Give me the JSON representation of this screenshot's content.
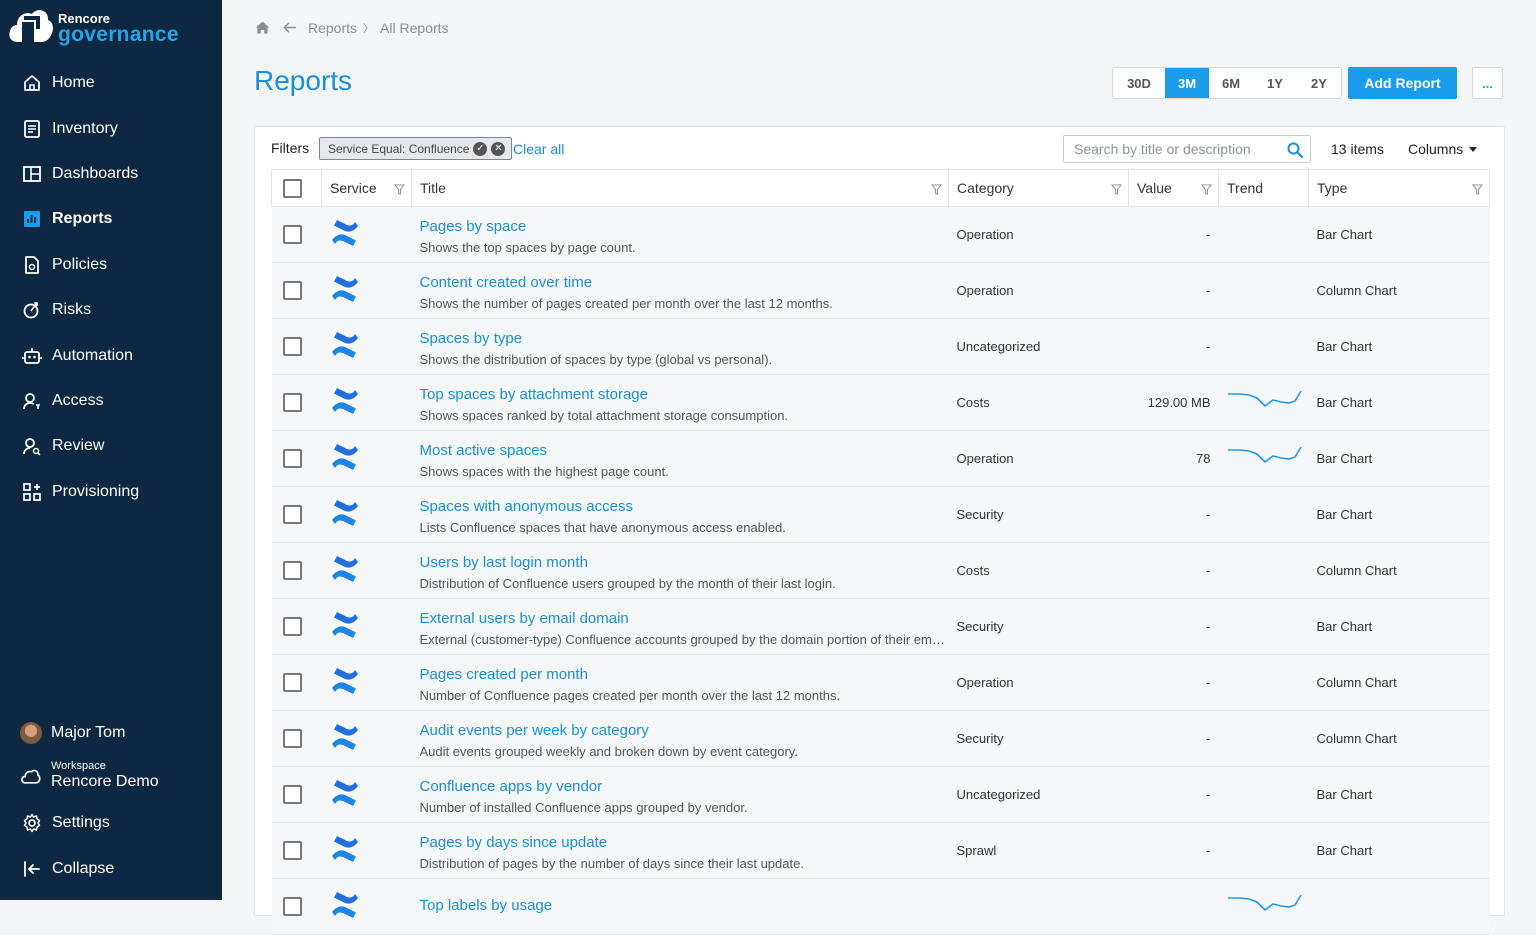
{
  "brand": {
    "line1": "Rencore",
    "line2": "governance"
  },
  "nav": [
    {
      "label": "Home",
      "icon": "home-icon"
    },
    {
      "label": "Inventory",
      "icon": "inventory-icon"
    },
    {
      "label": "Dashboards",
      "icon": "dashboards-icon"
    },
    {
      "label": "Reports",
      "icon": "reports-icon",
      "active": true
    },
    {
      "label": "Policies",
      "icon": "policies-icon"
    },
    {
      "label": "Risks",
      "icon": "risks-icon"
    },
    {
      "label": "Automation",
      "icon": "automation-icon"
    },
    {
      "label": "Access",
      "icon": "access-icon"
    },
    {
      "label": "Review",
      "icon": "review-icon"
    },
    {
      "label": "Provisioning",
      "icon": "provisioning-icon"
    }
  ],
  "user": {
    "name": "Major Tom"
  },
  "workspace": {
    "label": "Workspace",
    "name": "Rencore Demo"
  },
  "bottom_nav": {
    "settings": "Settings",
    "collapse": "Collapse"
  },
  "breadcrumb": {
    "reports": "Reports",
    "sep": "〉",
    "all": "All Reports"
  },
  "page_title": "Reports",
  "periods": [
    "30D",
    "3M",
    "6M",
    "1Y",
    "2Y"
  ],
  "selected_period": "3M",
  "add_report": "Add Report",
  "more": "...",
  "filters": {
    "label": "Filters",
    "chip": "Service Equal: Confluence",
    "clear": "Clear all"
  },
  "search": {
    "placeholder": "Search by title or description"
  },
  "items_count": "13 items",
  "columns_label": "Columns",
  "table": {
    "headers": {
      "service": "Service",
      "title": "Title",
      "category": "Category",
      "value": "Value",
      "trend": "Trend",
      "type": "Type"
    },
    "rows": [
      {
        "title": "Pages by space",
        "desc": "Shows the top spaces by page count.",
        "category": "Operation",
        "value": "-",
        "trend": false,
        "type": "Bar Chart"
      },
      {
        "title": "Content created over time",
        "desc": "Shows the number of pages created per month over the last 12 months.",
        "category": "Operation",
        "value": "-",
        "trend": false,
        "type": "Column Chart"
      },
      {
        "title": "Spaces by type",
        "desc": "Shows the distribution of spaces by type (global vs personal).",
        "category": "Uncategorized",
        "value": "-",
        "trend": false,
        "type": "Bar Chart"
      },
      {
        "title": "Top spaces by attachment storage",
        "desc": "Shows spaces ranked by total attachment storage consumption.",
        "category": "Costs",
        "value": "129.00 MB",
        "trend": true,
        "type": "Bar Chart"
      },
      {
        "title": "Most active spaces",
        "desc": "Shows spaces with the highest page count.",
        "category": "Operation",
        "value": "78",
        "trend": true,
        "type": "Bar Chart"
      },
      {
        "title": "Spaces with anonymous access",
        "desc": "Lists Confluence spaces that have anonymous access enabled.",
        "category": "Security",
        "value": "-",
        "trend": false,
        "type": "Bar Chart"
      },
      {
        "title": "Users by last login month",
        "desc": "Distribution of Confluence users grouped by the month of their last login.",
        "category": "Costs",
        "value": "-",
        "trend": false,
        "type": "Column Chart"
      },
      {
        "title": "External users by email domain",
        "desc": "External (customer-type) Confluence accounts grouped by the domain portion of their email address.",
        "category": "Security",
        "value": "-",
        "trend": false,
        "type": "Bar Chart"
      },
      {
        "title": "Pages created per month",
        "desc": "Number of Confluence pages created per month over the last 12 months.",
        "category": "Operation",
        "value": "-",
        "trend": false,
        "type": "Column Chart"
      },
      {
        "title": "Audit events per week by category",
        "desc": "Audit events grouped weekly and broken down by event category.",
        "category": "Security",
        "value": "-",
        "trend": false,
        "type": "Column Chart"
      },
      {
        "title": "Confluence apps by vendor",
        "desc": "Number of installed Confluence apps grouped by vendor.",
        "category": "Uncategorized",
        "value": "-",
        "trend": false,
        "type": "Bar Chart"
      },
      {
        "title": "Pages by days since update",
        "desc": "Distribution of pages by the number of days since their last update.",
        "category": "Sprawl",
        "value": "-",
        "trend": false,
        "type": "Bar Chart"
      },
      {
        "title": "Top labels by usage",
        "desc": "",
        "category": "",
        "value": "",
        "trend": true,
        "type": ""
      }
    ]
  },
  "colors": {
    "sidebar": "#0e2842",
    "accent": "#1b9cea",
    "link": "#1b8fd6"
  }
}
